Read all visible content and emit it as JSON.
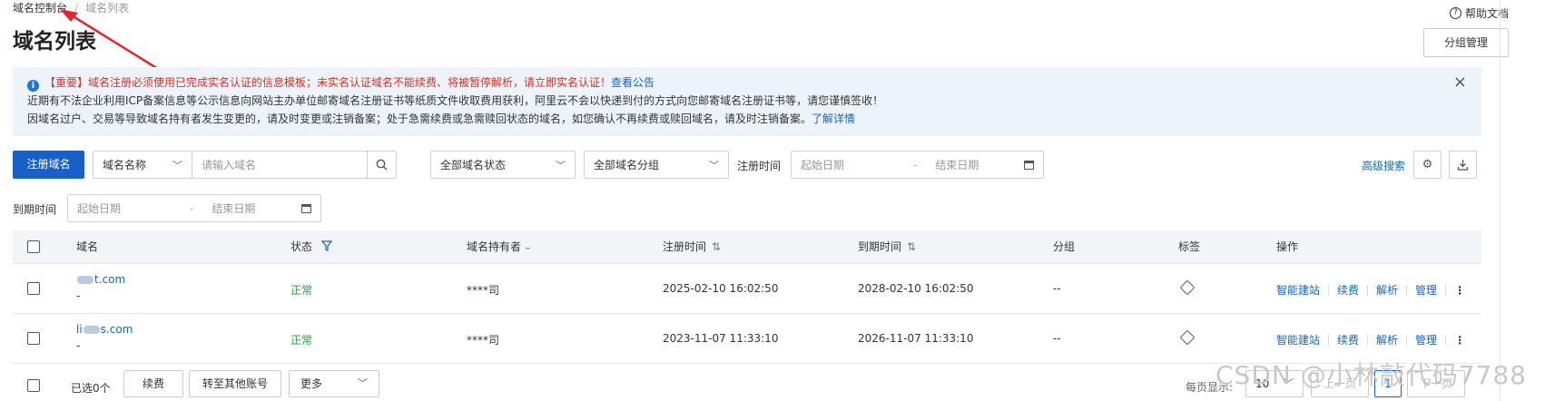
{
  "breadcrumb": {
    "item1": "域名控制台",
    "item2": "域名列表"
  },
  "page_title": "域名列表",
  "help_label": "帮助文档",
  "group_manage_label": "分组管理",
  "notice": {
    "prefix": "【重要】域名注册必须使用已完成实名认证的信息模板；未实名认证域名不能续费、将被暂停解析，请立即实名认证！",
    "prefix_link": "查看公告",
    "line2": "近期有不法企业利用ICP备案信息等公示信息向网站主办单位邮寄域名注册证书等纸质文件收取费用获利，阿里云不会以快递到付的方式向您邮寄域名注册证书等，请您谨慎签收！",
    "line3": "因域名过户、交易等导致域名持有者发生变更的，请及时变更或注销备案；处于急需续费或急需赎回状态的域名，如您确认不再续费或赎回域名，请及时注销备案。",
    "line3_link": "了解详情",
    "close": "×"
  },
  "toolbar": {
    "register_label": "注册域名",
    "search_field": "域名名称",
    "search_placeholder": "请输入域名",
    "status_select": "全部域名状态",
    "group_select": "全部域名分组",
    "reg_time_label": "注册时间",
    "start_date": "起始日期",
    "end_date": "结束日期",
    "date_sep": "-",
    "advanced_search": "高级搜索",
    "expire_time_label": "到期时间"
  },
  "table": {
    "headers": {
      "domain": "域名",
      "status": "状态",
      "holder": "域名持有者",
      "reg_time": "注册时间",
      "expire_time": "到期时间",
      "group": "分组",
      "tag": "标签",
      "ops": "操作"
    },
    "rows": [
      {
        "domain_a": "",
        "domain_b": "t.com",
        "sub": "-",
        "status": "正常",
        "holder": "****司",
        "reg_time": "2025-02-10 16:02:50",
        "expire_time": "2028-02-10 16:02:50",
        "group": "--"
      },
      {
        "domain_a": "li",
        "domain_b": "s.com",
        "sub": "-",
        "status": "正常",
        "holder": "****司",
        "reg_time": "2023-11-07 11:33:10",
        "expire_time": "2026-11-07 11:33:10",
        "group": "--"
      }
    ],
    "ops": {
      "site": "智能建站",
      "renew": "续费",
      "dns": "解析",
      "manage": "管理",
      "more": "⋮"
    }
  },
  "footer": {
    "selected": "已选0个",
    "renew": "续费",
    "transfer": "转至其他账号",
    "more": "更多",
    "per_page_label": "每页显示:",
    "per_page_value": "10",
    "prev": "上一页",
    "next": "下一页",
    "page": "1"
  },
  "watermark": "CSDN @小林敲代码7788"
}
